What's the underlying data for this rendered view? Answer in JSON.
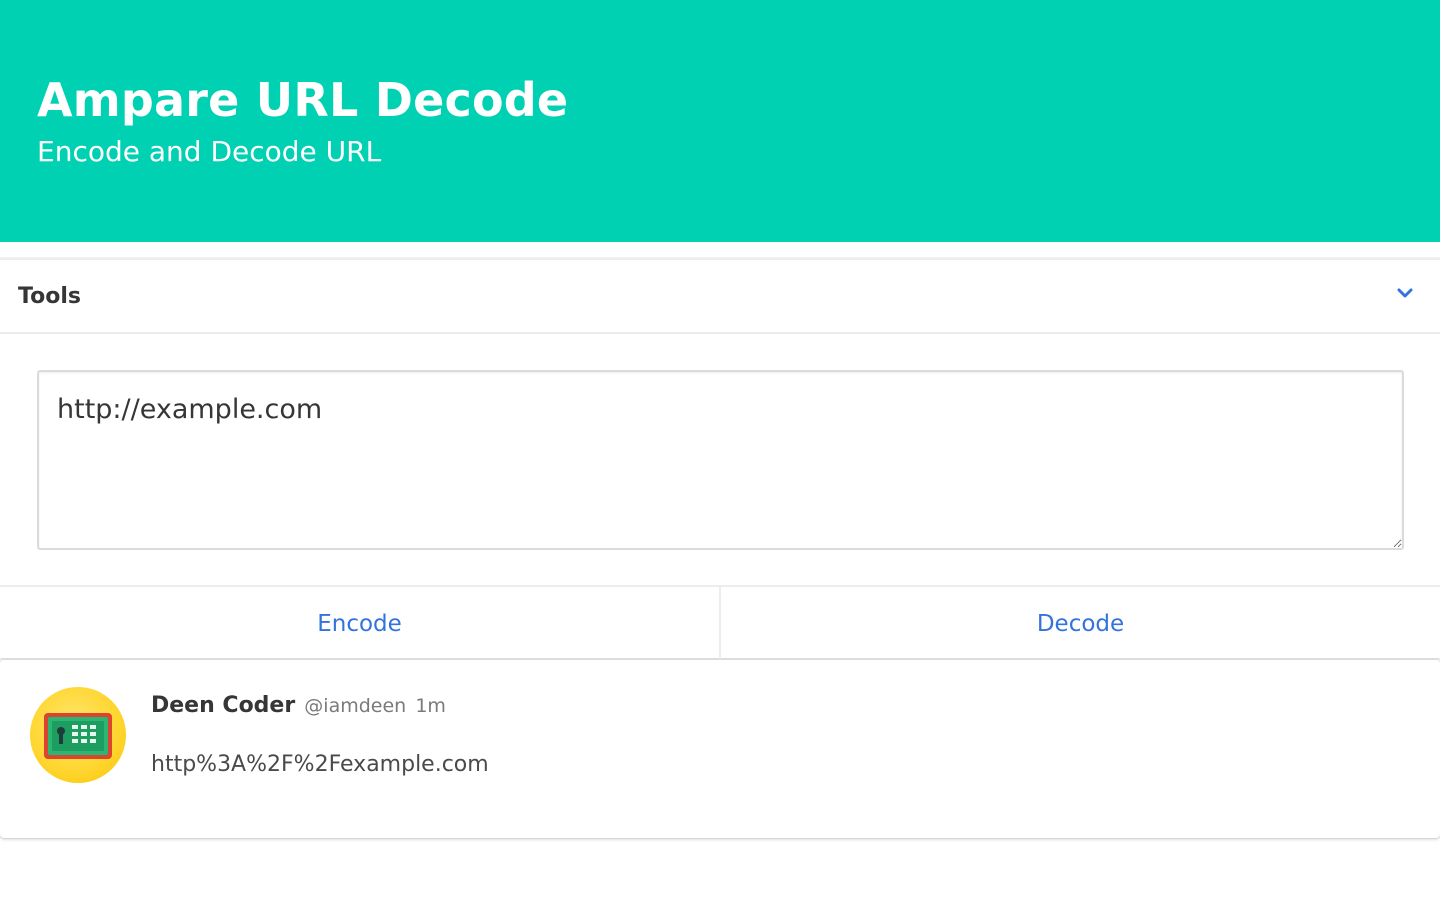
{
  "hero": {
    "title": "Ampare URL Decode",
    "subtitle": "Encode and Decode URL",
    "background_color": "#00d1b2"
  },
  "tools_panel": {
    "title": "Tools",
    "toggle_icon": "chevron-down-icon",
    "input_value": "http://example.com",
    "actions": {
      "encode_label": "Encode",
      "decode_label": "Decode"
    },
    "link_color": "#3273dc"
  },
  "result": {
    "author_name": "Deen Coder",
    "author_handle": "@iamdeen",
    "time_ago": "1m",
    "output_text": "http%3A%2F%2Fexample.com",
    "avatar_icon": "safe-keypad-icon"
  }
}
